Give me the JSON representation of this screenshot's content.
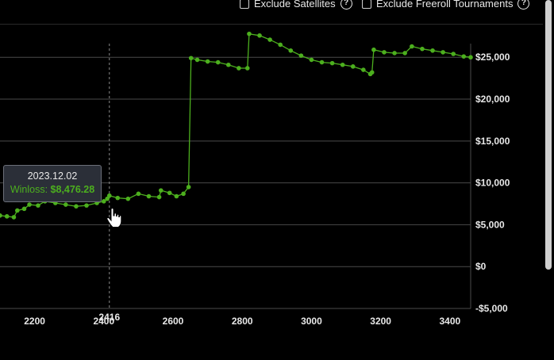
{
  "filters": {
    "exclude_satellites": "Exclude Satellites",
    "exclude_freeroll": "Exclude Freeroll Tournaments",
    "help_glyph": "?"
  },
  "tooltip": {
    "date": "2023.12.02",
    "label": "Winloss:",
    "value": "$8,476.28"
  },
  "colors": {
    "series": "#4caf1e",
    "grid": "#4a4a4a",
    "background": "#000000",
    "tooltip_bg": "#2b2f38"
  },
  "chart_data": {
    "type": "line",
    "title": "",
    "xlabel": "",
    "ylabel": "",
    "x_ticks": [
      2200,
      2400,
      2600,
      2800,
      3000,
      3200,
      3400
    ],
    "y_ticks": [
      -5000,
      0,
      5000,
      10000,
      15000,
      20000,
      25000
    ],
    "y_tick_labels": [
      "-$5,000",
      "$0",
      "$5,000",
      "$10,000",
      "$15,000",
      "$20,000",
      "$25,000"
    ],
    "xlim": [
      2100,
      3460
    ],
    "ylim": [
      -5000,
      29000
    ],
    "crosshair_x": 2416,
    "crosshair_label": "2416",
    "grid": true,
    "series": [
      {
        "values": [
          [
            2100,
            6100
          ],
          [
            2120,
            6000
          ],
          [
            2140,
            5900
          ],
          [
            2150,
            6700
          ],
          [
            2170,
            6900
          ],
          [
            2185,
            7400
          ],
          [
            2210,
            7300
          ],
          [
            2230,
            7800
          ],
          [
            2260,
            7600
          ],
          [
            2290,
            7400
          ],
          [
            2320,
            7200
          ],
          [
            2350,
            7300
          ],
          [
            2380,
            7600
          ],
          [
            2400,
            7800
          ],
          [
            2410,
            8100
          ],
          [
            2416,
            8476
          ],
          [
            2440,
            8200
          ],
          [
            2470,
            8100
          ],
          [
            2500,
            8700
          ],
          [
            2530,
            8400
          ],
          [
            2560,
            8300
          ],
          [
            2565,
            9100
          ],
          [
            2590,
            8800
          ],
          [
            2610,
            8400
          ],
          [
            2630,
            8700
          ],
          [
            2645,
            9500
          ],
          [
            2652,
            24900
          ],
          [
            2670,
            24700
          ],
          [
            2700,
            24500
          ],
          [
            2730,
            24400
          ],
          [
            2760,
            24100
          ],
          [
            2790,
            23700
          ],
          [
            2815,
            23700
          ],
          [
            2820,
            27800
          ],
          [
            2850,
            27600
          ],
          [
            2880,
            27100
          ],
          [
            2910,
            26500
          ],
          [
            2940,
            25800
          ],
          [
            2970,
            25200
          ],
          [
            3000,
            24700
          ],
          [
            3030,
            24400
          ],
          [
            3060,
            24300
          ],
          [
            3090,
            24100
          ],
          [
            3120,
            23900
          ],
          [
            3150,
            23500
          ],
          [
            3170,
            23000
          ],
          [
            3175,
            23200
          ],
          [
            3180,
            25900
          ],
          [
            3210,
            25600
          ],
          [
            3240,
            25500
          ],
          [
            3270,
            25500
          ],
          [
            3290,
            26300
          ],
          [
            3320,
            26000
          ],
          [
            3350,
            25800
          ],
          [
            3380,
            25600
          ],
          [
            3410,
            25400
          ],
          [
            3440,
            25100
          ],
          [
            3460,
            25000
          ]
        ]
      }
    ]
  }
}
